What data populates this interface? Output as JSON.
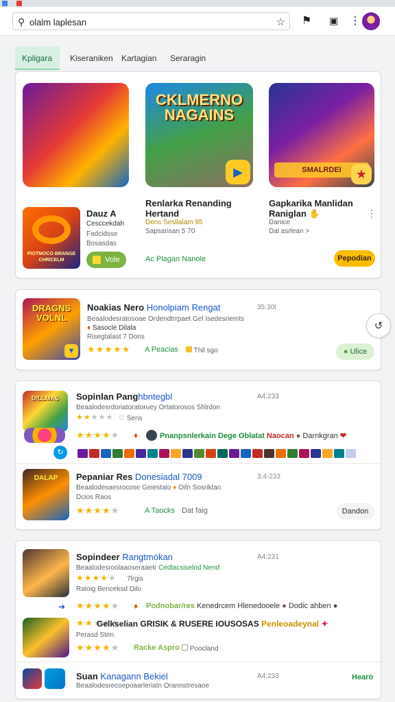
{
  "browser": {
    "address_text": "olalm laplesan",
    "search_icon": "search-icon",
    "bookmark_icon": "star-icon"
  },
  "tabs": [
    {
      "label": "Kpligara",
      "active": true
    },
    {
      "label": "Kiseraniken"
    },
    {
      "label": "Kartagian"
    },
    {
      "label": "Seraragin"
    }
  ],
  "featured": {
    "items": [
      {
        "title": "",
        "art": "heroes"
      },
      {
        "title": "CKLMERNO NAGAINS",
        "art": "warrior"
      },
      {
        "title": "SMALRDEI",
        "art": "battle"
      }
    ],
    "app": {
      "name": "Dauz A",
      "sub1": "Cesccekdah",
      "sub2": "Fadcidsse",
      "sub3": "Bosasdas",
      "logo_text": "PIOTMOCO BRANGE CHRICELM",
      "tag": "Vole"
    },
    "col2": {
      "title": "Renlarka Renanding",
      "subtitle": "Hertand",
      "meta": "Dens Sesllalam 95",
      "meta2": "Sapsarisan 5 70",
      "link": "Ac Plagan Nanole"
    },
    "col3": {
      "title": "Gapkarika Manlidan",
      "subtitle": "Raniglan",
      "meta": "Danice",
      "meta2": "Dal asrlean >",
      "button": "Pepodian"
    }
  },
  "list1": {
    "title_a": "Noakias Nero",
    "title_b": "Honolpiam Rengat",
    "time": "35:30t",
    "desc1": "Beaalodesratosoae Ordendtrrpaet Gel Isedesriemts",
    "desc2": "Sasocle Dilala",
    "desc3": "Risegtalast 7 Dons",
    "link": "Peacias",
    "tag": "Thil sgo",
    "button": "Ulice",
    "art_title": "DRAGNS VOLNL"
  },
  "list2": {
    "row1": {
      "title_a": "Sopinlan Pang",
      "title_b": "hbntegbl",
      "time": "A4:233",
      "desc": "Beaalodesrdoriatoratoruey Ortatorosos Shlrdon",
      "meta": "Sens",
      "inline": "Pnanpsnlerkain Dege Oblatat",
      "inline2": "Naocan",
      "inline3": "Darnkgran",
      "art_title": "DILLMAS"
    },
    "row2": {
      "title_a": "Pepaniar Res",
      "title_b": "Donesiadal 7009",
      "time": "3:4-233",
      "desc": "Beaalodesaesrocose Geiestalo",
      "desc_b": "Oiln Sosriktan",
      "meta": "Dcios Raos",
      "link": "Taocks",
      "tag": "Dat faig",
      "button": "Dandon",
      "art_title": "DALAP"
    }
  },
  "list3": {
    "row1": {
      "title_a": "Sopindeer",
      "title_b": "Rangtmökan",
      "time": "A4:231",
      "desc": "Beaalodesroolaaoseraaetr",
      "desc_b": "Cedlacsiselnd Nend",
      "meta": "7lrgis",
      "meta2": "Raloig Benceksd Dilo",
      "inline": "Podnobar/res",
      "inline2": "Kenedrcem Hlenedooele",
      "inline3": "Dodic ahben"
    },
    "row2": {
      "title_a": "Gelkselian GRISIK & RUSERE IOUSOSAS",
      "title_b": "Penleoadeynal",
      "desc": "Perasd Sten",
      "link": "Racke Aspro",
      "tag": "Poocland"
    },
    "row3": {
      "title_a": "Suan",
      "title_b": "Kanagann Bekiel",
      "time": "A4:233",
      "desc": "Beaalodesrecoepoaarleriatn Orannstresaoe",
      "link": "Hearo"
    }
  },
  "colors": {
    "accent_green": "#1e8e3e",
    "accent_blue": "#1a56c5",
    "star": "#f4b400",
    "tab_active_bg": "#d7f0e3"
  },
  "ratings": {
    "list1": 5,
    "list2_row1_meta": 2,
    "list2_row1": 4,
    "list2_row2": 4,
    "list3_row1": 4,
    "list3_row1_inline": 4,
    "list3_row2_inline": 2,
    "list3_row2": 4
  }
}
